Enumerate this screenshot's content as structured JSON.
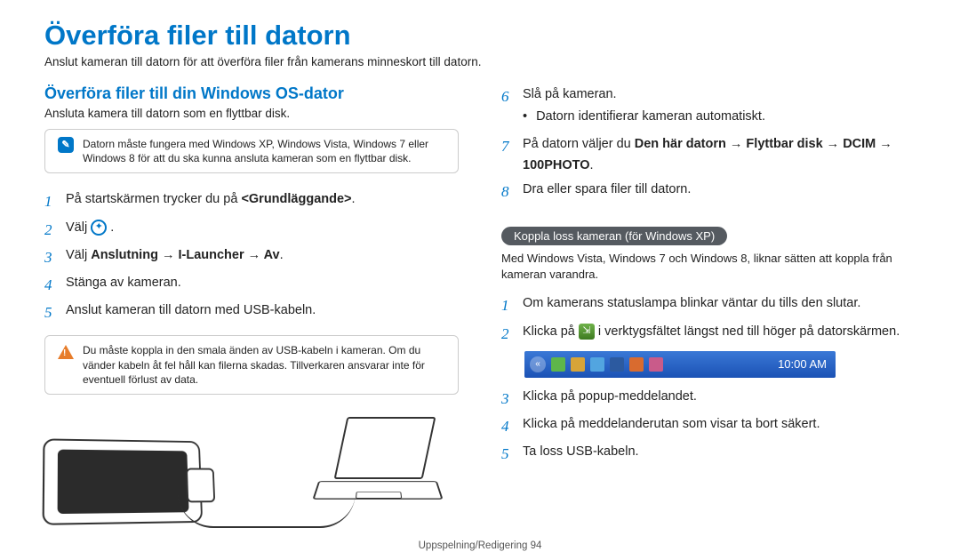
{
  "main_title": "Överföra filer till datorn",
  "subtitle": "Anslut kameran till datorn för att överföra filer från kamerans minneskort till datorn.",
  "section_heading": "Överföra filer till din Windows OS-dator",
  "intro_line": "Ansluta kamera till datorn som en flyttbar disk.",
  "info_note": "Datorn måste fungera med Windows XP, Windows Vista, Windows 7 eller Windows 8 för att du ska kunna ansluta kameran som en flyttbar disk.",
  "left_steps": [
    {
      "n": "1",
      "html": "På startskärmen trycker du på <strong>&lt;Grundläggande&gt;</strong>."
    },
    {
      "n": "2",
      "html": "Välj "
    },
    {
      "n": "3",
      "html": "Välj <strong>Anslutning → I-Launcher → Av</strong>."
    },
    {
      "n": "4",
      "html": "Stänga av kameran."
    },
    {
      "n": "5",
      "html": "Anslut kameran till datorn med USB-kabeln."
    }
  ],
  "warn_note": "Du måste koppla in den smala änden av USB-kabeln i kameran. Om du vänder kabeln åt fel håll kan filerna skadas. Tillverkaren ansvarar inte för eventuell förlust av data.",
  "right_steps_a": [
    {
      "n": "6",
      "html": "Slå på kameran.",
      "bullet": "Datorn identifierar kameran automatiskt."
    },
    {
      "n": "7",
      "html": "På datorn väljer du <strong>Den här datorn → Flyttbar disk → DCIM → 100PHOTO</strong>."
    },
    {
      "n": "8",
      "html": "Dra eller spara filer till datorn."
    }
  ],
  "badge_heading": "Koppla loss kameran (för Windows XP)",
  "badge_intro": "Med Windows Vista, Windows 7 och Windows 8, liknar sätten att koppla från kameran varandra.",
  "right_steps_b": [
    {
      "n": "1",
      "html": "Om kamerans statuslampa blinkar väntar du tills den slutar."
    },
    {
      "n": "2",
      "html": "Klicka på  i verktygsfältet längst ned till höger på datorskärmen."
    },
    {
      "n": "3",
      "html": "Klicka på popup-meddelandet."
    },
    {
      "n": "4",
      "html": "Klicka på meddelanderutan som visar ta bort säkert."
    },
    {
      "n": "5",
      "html": "Ta loss USB-kabeln."
    }
  ],
  "taskbar_clock": "10:00 AM",
  "footer": "Uppspelning/Redigering  94",
  "icon_labels": {
    "step2": "."
  }
}
